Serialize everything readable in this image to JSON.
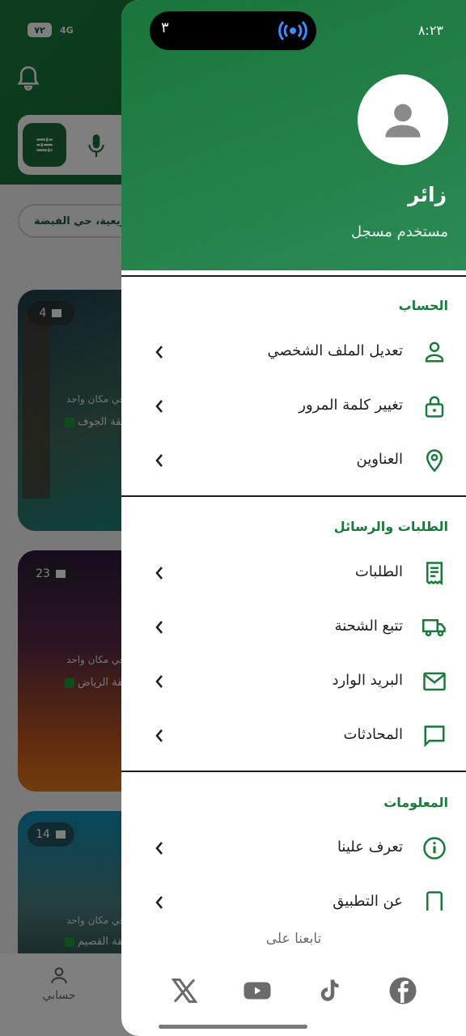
{
  "background_app": {
    "status": {
      "battery": "٧٢",
      "network": "4G"
    },
    "chip_text": "القويعية، حي الفيضة",
    "cards": [
      {
        "count": "4",
        "subtitle": "في مكان واحد",
        "city": "منطقة الجوف"
      },
      {
        "count": "23",
        "subtitle": "في مكان واحد",
        "city": "منطقة الرياض"
      },
      {
        "count": "14",
        "subtitle": "في مكان واحد",
        "city": "منطقة القصيم"
      }
    ],
    "bottom_nav": {
      "account_label": "حسابي"
    }
  },
  "status_bar": {
    "island_number": "٣",
    "time": "٨:٢٣"
  },
  "drawer": {
    "user": {
      "name": "زائر",
      "role": "مستخدم مسجل"
    },
    "sections": {
      "account": {
        "title": "الحساب",
        "items": [
          {
            "label": "تعديل الملف الشخصي",
            "icon": "person-icon"
          },
          {
            "label": "تغيير كلمة المرور",
            "icon": "lock-icon"
          },
          {
            "label": "العناوين",
            "icon": "location-pin-icon"
          }
        ]
      },
      "orders": {
        "title": "الطلبات والرسائل",
        "items": [
          {
            "label": "الطلبات",
            "icon": "receipt-icon"
          },
          {
            "label": "تتبع الشحنة",
            "icon": "truck-icon"
          },
          {
            "label": "البريد الوارد",
            "icon": "mail-icon"
          },
          {
            "label": "المحادثات",
            "icon": "chat-icon"
          }
        ]
      },
      "info": {
        "title": "المعلومات",
        "items": [
          {
            "label": "تعرف علينا",
            "icon": "info-icon"
          },
          {
            "label": "عن التطبيق",
            "icon": "phone-icon"
          }
        ]
      }
    },
    "follow_us": "تابعنا على",
    "social": [
      "x-icon",
      "youtube-icon",
      "tiktok-icon",
      "facebook-icon"
    ],
    "accent_color": "#1a7a3c"
  }
}
